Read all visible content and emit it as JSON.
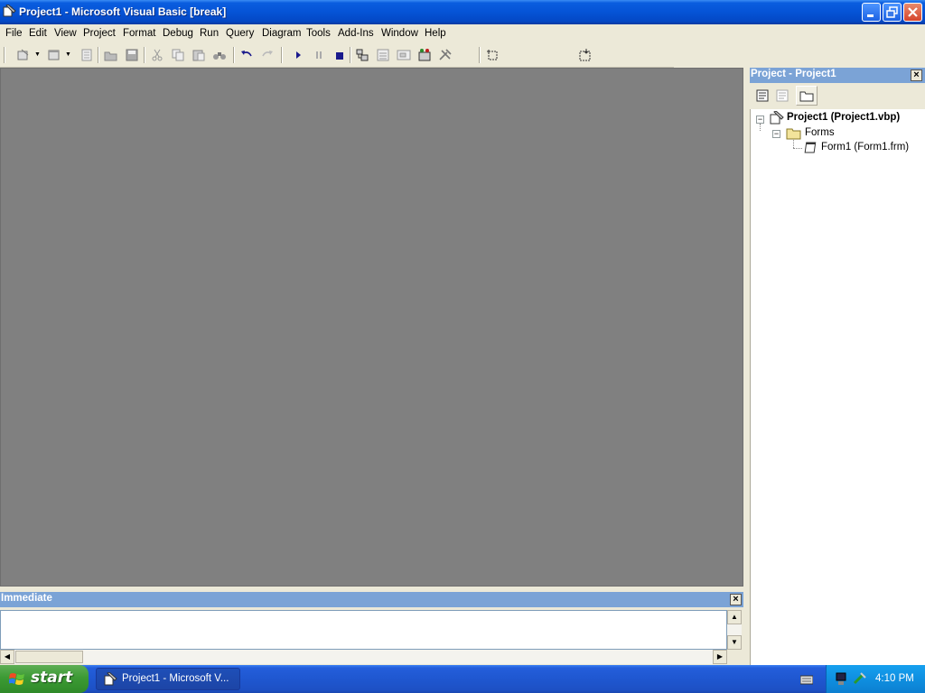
{
  "window": {
    "title": "Project1 - Microsoft Visual Basic [break]",
    "minimize_icon": "minimize-icon",
    "restore_icon": "restore-icon",
    "close_icon": "close-icon"
  },
  "menu": {
    "items": [
      "File",
      "Edit",
      "View",
      "Project",
      "Format",
      "Debug",
      "Run",
      "Query",
      "Diagram",
      "Tools",
      "Add-Ins",
      "Window",
      "Help"
    ]
  },
  "toolbar": {
    "buttons": [
      "add-project-icon",
      "add-form-icon",
      "menu-editor-icon",
      "open-project-icon",
      "save-project-icon",
      "cut-icon",
      "copy-icon",
      "paste-icon",
      "find-icon",
      "undo-icon",
      "redo-icon",
      "start-icon",
      "break-icon",
      "end-icon",
      "project-explorer-icon",
      "properties-window-icon",
      "form-layout-icon",
      "object-browser-icon",
      "toolbox-icon",
      "position-icon",
      "size-icon"
    ],
    "colors": {
      "run": "#1a1a8c",
      "face": "#ece9d8"
    }
  },
  "project_window": {
    "title": "Project - Project1",
    "toolbar_icons": [
      "view-code-icon",
      "view-object-icon",
      "toggle-folders-icon"
    ],
    "tree": {
      "root": "Project1 (Project1.vbp)",
      "folder": "Forms",
      "item": "Form1 (Form1.frm)"
    }
  },
  "immediate_window": {
    "title": "Immediate",
    "content": ""
  },
  "taskbar": {
    "start_label": "start",
    "task_label": "Project1 - Microsoft V...",
    "clock": "4:10 PM",
    "colors": {
      "taskbar": "#245edb",
      "start": "#3c9a34",
      "tray": "#0f8fe0"
    }
  }
}
